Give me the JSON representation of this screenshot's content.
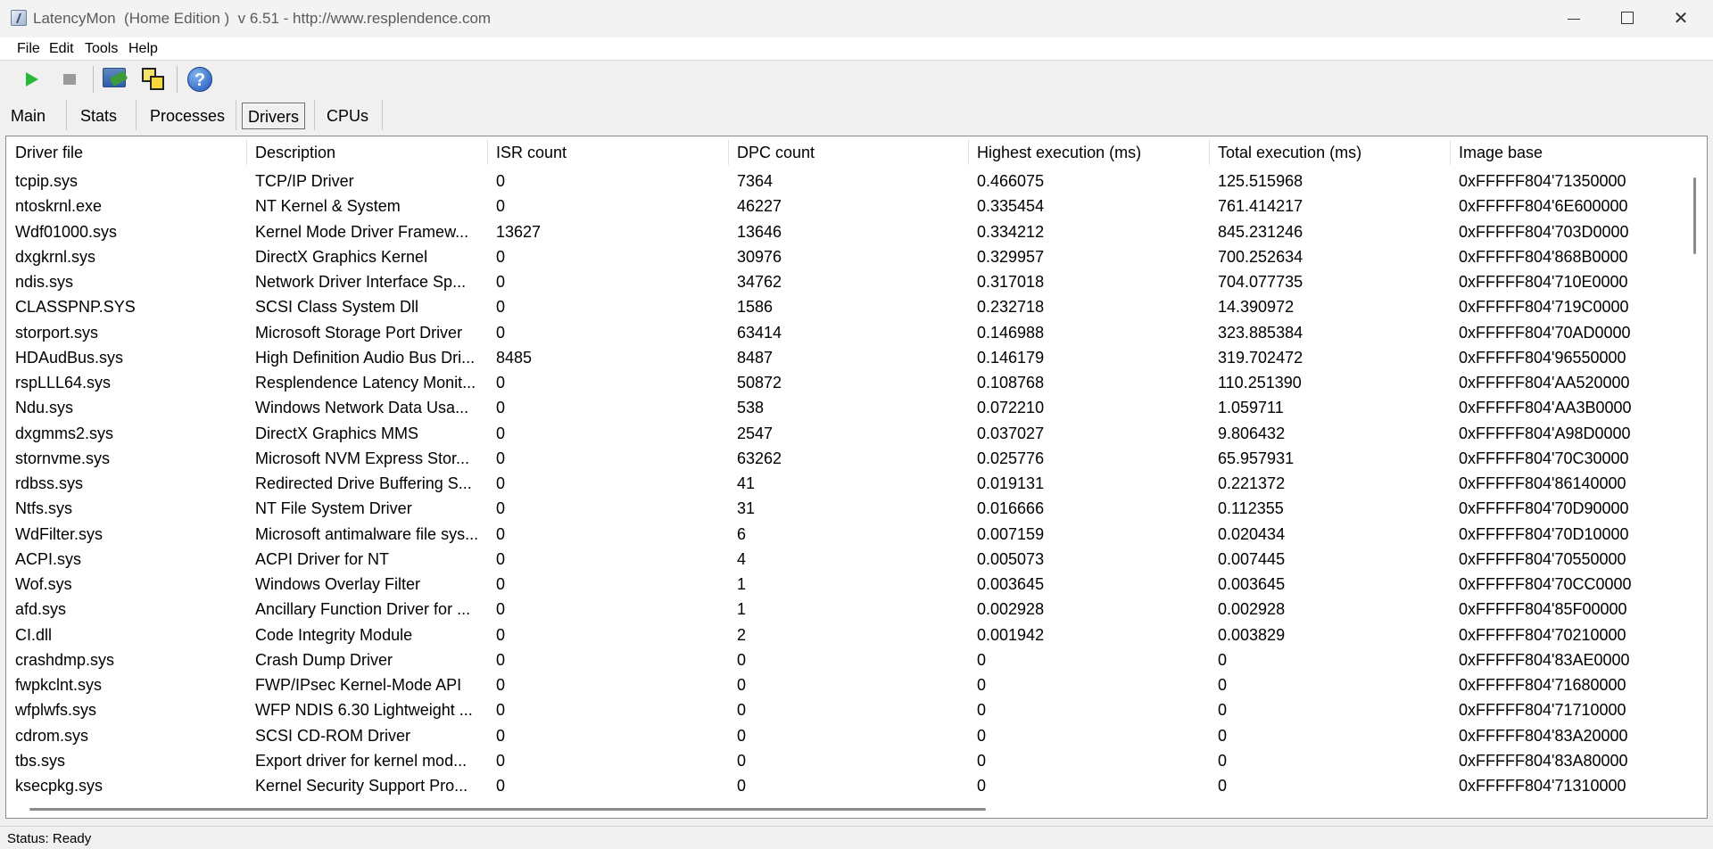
{
  "window": {
    "title": "LatencyMon  (Home Edition )  v 6.51 - http://www.resplendence.com",
    "icon": "latencymon-app-icon",
    "controls": {
      "minimize": "minimize-icon",
      "maximize": "maximize-icon",
      "close": "✕"
    }
  },
  "menu": [
    "File",
    "Edit",
    "Tools",
    "Help"
  ],
  "toolbar": {
    "buttons": [
      {
        "name": "start-monitoring",
        "icon": "play-icon",
        "color": "#28b83a"
      },
      {
        "name": "stop-monitoring",
        "icon": "stop-icon",
        "color": "#9a9a9a"
      },
      {
        "name": "system-info",
        "icon": "monitor-icon"
      },
      {
        "name": "windows",
        "icon": "windows-icon"
      },
      {
        "name": "help",
        "icon": "help-icon",
        "glyph": "?"
      }
    ]
  },
  "tabs": {
    "items": [
      "Main",
      "Stats",
      "Processes",
      "Drivers",
      "CPUs"
    ],
    "active": "Drivers"
  },
  "table": {
    "columns": [
      "Driver file",
      "Description",
      "ISR count",
      "DPC count",
      "Highest execution (ms)",
      "Total execution (ms)",
      "Image base"
    ],
    "rows": [
      [
        "tcpip.sys",
        "TCP/IP Driver",
        "0",
        "7364",
        "0.466075",
        "125.515968",
        "0xFFFFF804'71350000"
      ],
      [
        "ntoskrnl.exe",
        "NT Kernel & System",
        "0",
        "46227",
        "0.335454",
        "761.414217",
        "0xFFFFF804'6E600000"
      ],
      [
        "Wdf01000.sys",
        "Kernel Mode Driver Framew...",
        "13627",
        "13646",
        "0.334212",
        "845.231246",
        "0xFFFFF804'703D0000"
      ],
      [
        "dxgkrnl.sys",
        "DirectX Graphics Kernel",
        "0",
        "30976",
        "0.329957",
        "700.252634",
        "0xFFFFF804'868B0000"
      ],
      [
        "ndis.sys",
        "Network Driver Interface Sp...",
        "0",
        "34762",
        "0.317018",
        "704.077735",
        "0xFFFFF804'710E0000"
      ],
      [
        "CLASSPNP.SYS",
        "SCSI Class System Dll",
        "0",
        "1586",
        "0.232718",
        "14.390972",
        "0xFFFFF804'719C0000"
      ],
      [
        "storport.sys",
        "Microsoft Storage Port Driver",
        "0",
        "63414",
        "0.146988",
        "323.885384",
        "0xFFFFF804'70AD0000"
      ],
      [
        "HDAudBus.sys",
        "High Definition Audio Bus Dri...",
        "8485",
        "8487",
        "0.146179",
        "319.702472",
        "0xFFFFF804'96550000"
      ],
      [
        "rspLLL64.sys",
        "Resplendence Latency Monit...",
        "0",
        "50872",
        "0.108768",
        "110.251390",
        "0xFFFFF804'AA520000"
      ],
      [
        "Ndu.sys",
        "Windows Network Data Usa...",
        "0",
        "538",
        "0.072210",
        "1.059711",
        "0xFFFFF804'AA3B0000"
      ],
      [
        "dxgmms2.sys",
        "DirectX Graphics MMS",
        "0",
        "2547",
        "0.037027",
        "9.806432",
        "0xFFFFF804'A98D0000"
      ],
      [
        "stornvme.sys",
        "Microsoft NVM Express Stor...",
        "0",
        "63262",
        "0.025776",
        "65.957931",
        "0xFFFFF804'70C30000"
      ],
      [
        "rdbss.sys",
        "Redirected Drive Buffering S...",
        "0",
        "41",
        "0.019131",
        "0.221372",
        "0xFFFFF804'86140000"
      ],
      [
        "Ntfs.sys",
        "NT File System Driver",
        "0",
        "31",
        "0.016666",
        "0.112355",
        "0xFFFFF804'70D90000"
      ],
      [
        "WdFilter.sys",
        "Microsoft antimalware file sys...",
        "0",
        "6",
        "0.007159",
        "0.020434",
        "0xFFFFF804'70D10000"
      ],
      [
        "ACPI.sys",
        "ACPI Driver for NT",
        "0",
        "4",
        "0.005073",
        "0.007445",
        "0xFFFFF804'70550000"
      ],
      [
        "Wof.sys",
        "Windows Overlay Filter",
        "0",
        "1",
        "0.003645",
        "0.003645",
        "0xFFFFF804'70CC0000"
      ],
      [
        "afd.sys",
        "Ancillary Function Driver for ...",
        "0",
        "1",
        "0.002928",
        "0.002928",
        "0xFFFFF804'85F00000"
      ],
      [
        "CI.dll",
        "Code Integrity Module",
        "0",
        "2",
        "0.001942",
        "0.003829",
        "0xFFFFF804'70210000"
      ],
      [
        "crashdmp.sys",
        "Crash Dump Driver",
        "0",
        "0",
        "0",
        "0",
        "0xFFFFF804'83AE0000"
      ],
      [
        "fwpkclnt.sys",
        "FWP/IPsec Kernel-Mode API",
        "0",
        "0",
        "0",
        "0",
        "0xFFFFF804'71680000"
      ],
      [
        "wfplwfs.sys",
        "WFP NDIS 6.30 Lightweight ...",
        "0",
        "0",
        "0",
        "0",
        "0xFFFFF804'71710000"
      ],
      [
        "cdrom.sys",
        "SCSI CD-ROM Driver",
        "0",
        "0",
        "0",
        "0",
        "0xFFFFF804'83A20000"
      ],
      [
        "tbs.sys",
        "Export driver for kernel mod...",
        "0",
        "0",
        "0",
        "0",
        "0xFFFFF804'83A80000"
      ],
      [
        "ksecpkg.sys",
        "Kernel Security Support Pro...",
        "0",
        "0",
        "0",
        "0",
        "0xFFFFF804'71310000"
      ]
    ]
  },
  "status": "Status: Ready"
}
